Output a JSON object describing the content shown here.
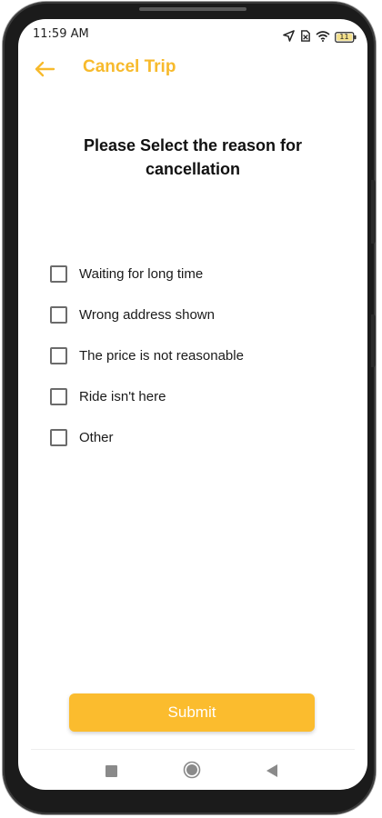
{
  "status_bar": {
    "time": "11:59 AM",
    "battery_level": "11",
    "icons": [
      "location-arrow-icon",
      "no-sim-icon",
      "wifi-icon",
      "battery-icon"
    ]
  },
  "app_bar": {
    "title": "Cancel Trip",
    "back_icon": "arrow-left-icon"
  },
  "heading": "Please Select the reason for cancellation",
  "reasons": [
    {
      "label": "Waiting for long time",
      "checked": false
    },
    {
      "label": "Wrong address shown",
      "checked": false
    },
    {
      "label": "The price is not reasonable",
      "checked": false
    },
    {
      "label": "Ride isn't here",
      "checked": false
    },
    {
      "label": "Other",
      "checked": false
    }
  ],
  "submit_label": "Submit",
  "nav_bar": {
    "icons": [
      "recents-square-icon",
      "home-circle-icon",
      "back-triangle-icon"
    ]
  },
  "colors": {
    "accent": "#f7ba2c",
    "button": "#fbbc2e",
    "button_text": "#ffffff",
    "checkbox_border": "#6b6b6b"
  }
}
